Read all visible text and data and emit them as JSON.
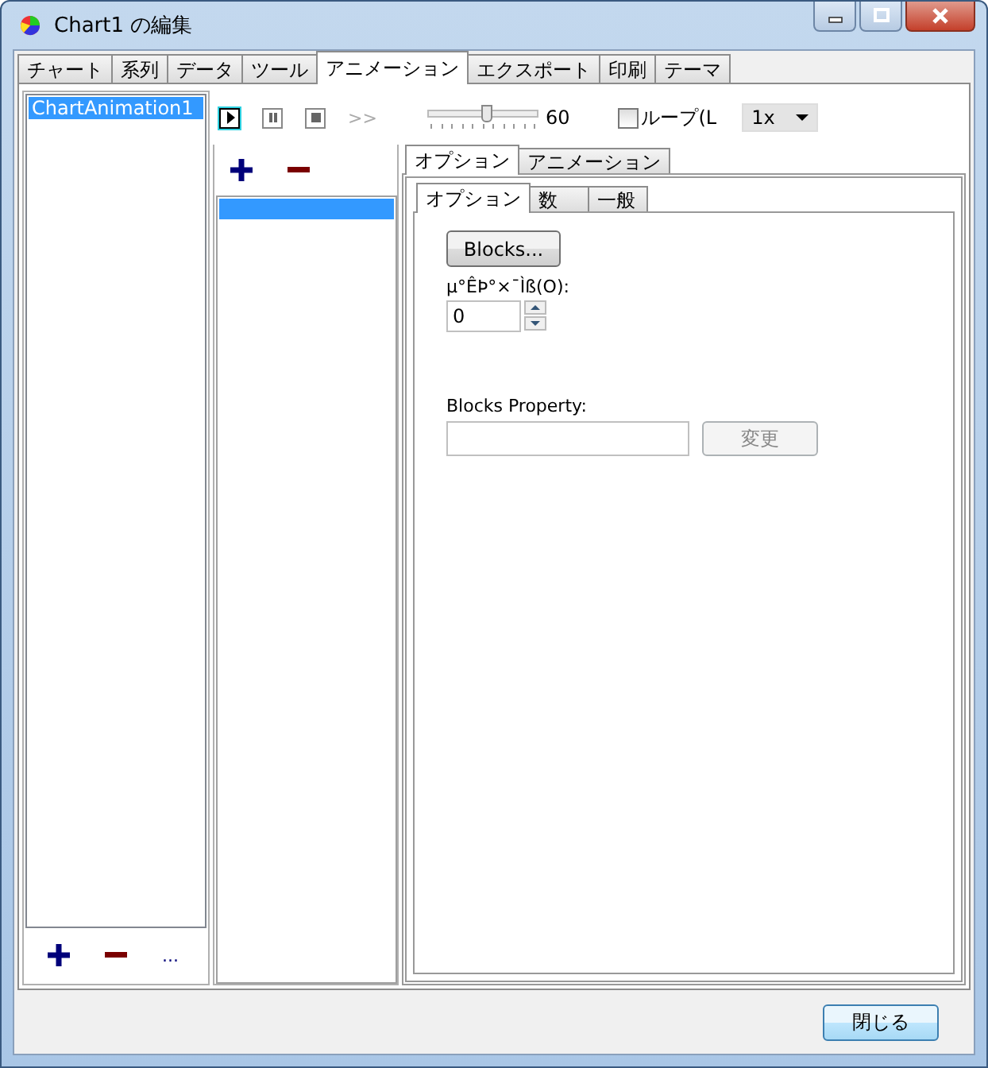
{
  "window": {
    "title": "Chart1 の編集"
  },
  "tabs": [
    {
      "label": "チャート",
      "selected": false
    },
    {
      "label": "系列",
      "selected": false
    },
    {
      "label": "データ",
      "selected": false
    },
    {
      "label": "ツール",
      "selected": false
    },
    {
      "label": "アニメーション",
      "selected": true
    },
    {
      "label": "エクスポート",
      "selected": false
    },
    {
      "label": "印刷",
      "selected": false
    },
    {
      "label": "テーマ",
      "selected": false
    }
  ],
  "animations": {
    "items": [
      {
        "label": "ChartAnimation1",
        "selected": true
      }
    ],
    "more_button": "..."
  },
  "player": {
    "controls": [
      {
        "kind": "play",
        "selected": true
      },
      {
        "kind": "pause",
        "selected": false
      },
      {
        "kind": "stop",
        "selected": false
      }
    ],
    "skip_button": {
      "label": ">>",
      "disabled": true
    },
    "speed_slider": {
      "level": 0.53,
      "reading": "60"
    },
    "loop": {
      "label": "ループ(L",
      "checked": false
    },
    "rate": {
      "value": "1x"
    }
  },
  "steps": {
    "items": [
      {
        "selected": true
      }
    ]
  },
  "property_tabs": [
    {
      "label": "オプション",
      "selected": true
    },
    {
      "label": "アニメーション",
      "selected": false
    }
  ],
  "option_tabs": [
    {
      "label": "オプション",
      "selected": true
    },
    {
      "label": "数",
      "selected": false
    },
    {
      "label": "一般",
      "selected": false
    }
  ],
  "options": {
    "blocks_button": "Blocks...",
    "number_label": "µ°ÊÞ°×¯Ìß(O):",
    "number_value": "0",
    "property_label": "Blocks Property:",
    "change_button": {
      "label": "変更",
      "disabled": true
    }
  },
  "footer": {
    "close_button": "閉じる"
  }
}
